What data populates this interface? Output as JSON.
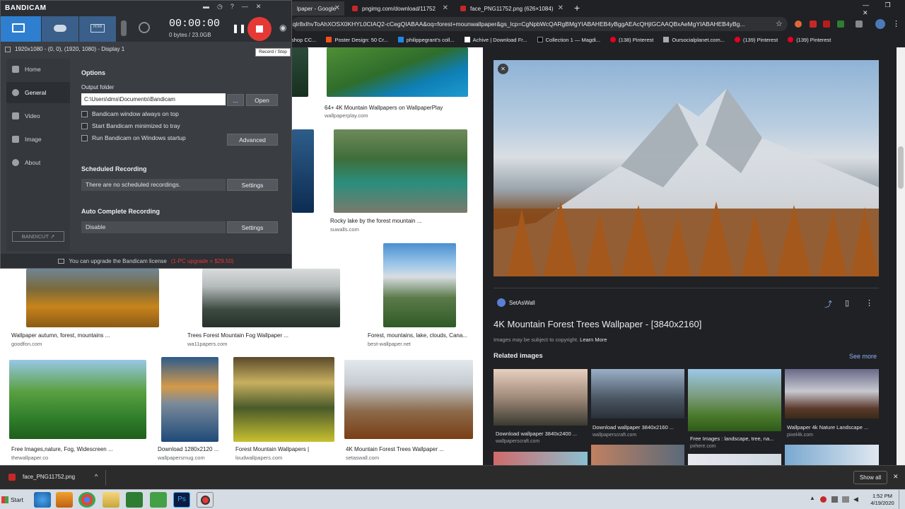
{
  "browser": {
    "tabs": [
      {
        "label": "lpaper - Google"
      },
      {
        "label": "pngimg.com/download/11752"
      },
      {
        "label": "face_PNG11752.png (626×1084)"
      }
    ],
    "new_tab_glyph": "+",
    "address": "qlr8xIhvToAhXOSX0KHYL0CIAQ2-cCegQIABAA&oq=forest+mounwallpaper&gs_lcp=CgNpbWcQARgBMgYIABAHEB4yBggAEAcQHjIGCAAQBxAeMgYIABAHEB4yBg...",
    "bookmarks": [
      "shop CC...",
      "Poster Design: 50 Cr...",
      "philippegrant's coll...",
      "Achive | Download Fr...",
      "Collection 1 — Magdi...",
      "(138) Pinterest",
      "Oursocialplanet.com...",
      "(139) Pinterest",
      "(139) Pinterest"
    ]
  },
  "results": [
    {
      "caption": "64+ 4K Mountain Wallpapers on WallpaperPlay",
      "source": "wallpaperplay.com"
    },
    {
      "caption": "Rocky lake by the forest mountain ...",
      "source": "suwalls.com"
    },
    {
      "caption": "Wallpaper autumn, forest, mountains ...",
      "source": "goodfon.com"
    },
    {
      "caption": "Trees Forest Mountain Fog Wallpaper ...",
      "source": "wa11papers.com"
    },
    {
      "caption": "Forest, mountains, lake, clouds, Cana...",
      "source": "best-wallpaper.net"
    },
    {
      "caption": "Free Images,nature, Fog, Widescreen ...",
      "source": "thewallpaper.co"
    },
    {
      "caption": "Download 1280x2120 ...",
      "source": "wallpapersmug.com"
    },
    {
      "caption": "Forest Mountain Wallpapers |",
      "source": "loudwallpapers.com"
    },
    {
      "caption": "4K Mountain Forest Trees Wallpaper ...",
      "source": "setaswall.com"
    }
  ],
  "preview": {
    "close_glyph": "✕",
    "site": "SetAsWall",
    "title": "4K Mountain Forest Trees Wallpaper - [3840x2160]",
    "copyright": "Images may be subject to copyright.",
    "learn_more": "Learn More",
    "related_heading": "Related images",
    "see_more": "See more",
    "related": [
      {
        "caption": "Download wallpaper 3840x2400 ...",
        "source": "wallpaperscraft.com"
      },
      {
        "caption": "Download wallpaper 3840x2160 ...",
        "source": "wallpaperscraft.com"
      },
      {
        "caption": "Free Images : landscape, tree, na...",
        "source": "pxhere.com"
      },
      {
        "caption": "Wallpaper 4k Nature Landscape ...",
        "source": "pixel4k.com"
      }
    ]
  },
  "bandicam": {
    "logo": "BANDICAM",
    "timer": "00:00:00",
    "size": "0 bytes / 23.0GB",
    "tooltip": "Record / Stop",
    "display_info": "1920x1080 - (0, 0), (1920, 1080) - Display 1",
    "sidebar": [
      "Home",
      "General",
      "Video",
      "Image",
      "About"
    ],
    "bandicut": "BANDICUT ↗",
    "options_title": "Options",
    "output_label": "Output folder",
    "output_path": "C:\\Users\\dms\\Documents\\Bandicam",
    "browse": "...",
    "open": "Open",
    "checks": [
      "Bandicam window always on top",
      "Start Bandicam minimized to tray",
      "Run Bandicam on Windows startup"
    ],
    "advanced": "Advanced",
    "scheduled_title": "Scheduled Recording",
    "scheduled_text": "There are no scheduled recordings.",
    "settings": "Settings",
    "auto_title": "Auto Complete Recording",
    "auto_text": "Disable",
    "upgrade_text": "You can upgrade the Bandicam license",
    "upgrade_offer": "(1-PC upgrade = $29.50)"
  },
  "downloads": {
    "file": "face_PNG11752.png",
    "show_all": "Show all",
    "caret": "^",
    "close": "✕"
  },
  "taskbar": {
    "start": "Start",
    "time": "1:52 PM",
    "date": "4/19/2020"
  },
  "colors": {
    "record": "#e53935",
    "accent_blue": "#8ab4f8",
    "bandicam_bg": "#3a3d42"
  }
}
